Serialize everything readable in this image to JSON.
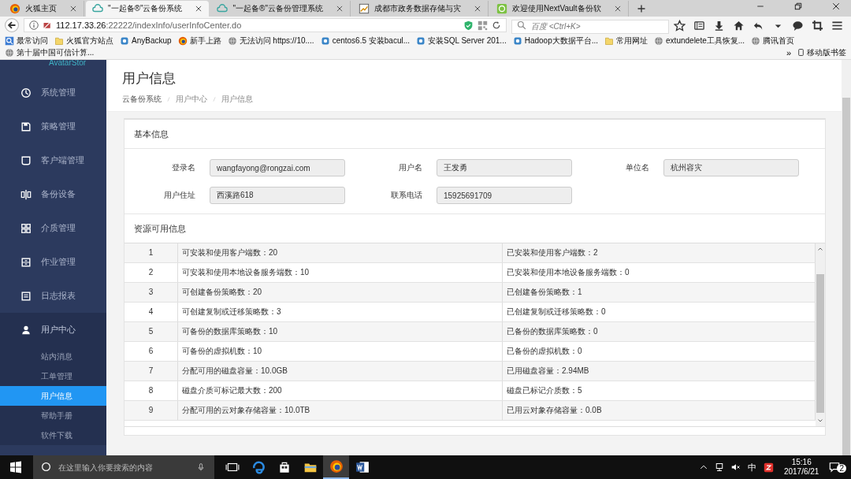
{
  "browser": {
    "tabs": [
      {
        "title": "火狐主页",
        "kind": "firefox",
        "selected": false
      },
      {
        "title": "\"一起备®\"云备份系统",
        "kind": "cloud",
        "selected": true
      },
      {
        "title": "\"一起备®\"云备份管理系统",
        "kind": "cloud",
        "selected": false
      },
      {
        "title": "成都市政务数据存储与灾",
        "kind": "chart",
        "selected": false
      },
      {
        "title": "欢迎使用NextVault备份软",
        "kind": "vault",
        "selected": false
      }
    ],
    "address": {
      "host": "112.17.33.26",
      "path": ":22222/indexInfo/userInfoCenter.do"
    },
    "search": {
      "placeholder": "百度 <Ctrl+K>"
    },
    "bookmarks": [
      {
        "label": "最常访问",
        "kind": "search"
      },
      {
        "label": "火狐官方站点",
        "kind": "folder"
      },
      {
        "label": "AnyBackup",
        "kind": "app"
      },
      {
        "label": "新手上路",
        "kind": "firefox"
      },
      {
        "label": "无法访问 https://10....",
        "kind": "globe"
      },
      {
        "label": "centos6.5 安装bacul...",
        "kind": "app"
      },
      {
        "label": "安装SQL Server 201...",
        "kind": "app"
      },
      {
        "label": "Hadoop大数据平台...",
        "kind": "app"
      },
      {
        "label": "常用网址",
        "kind": "folder"
      },
      {
        "label": "extundelete工具恢复...",
        "kind": "globe"
      },
      {
        "label": "腾讯首页",
        "kind": "globe"
      },
      {
        "label": "第十届中国可信计算...",
        "kind": "globe"
      }
    ],
    "bookmarks_more": "»",
    "mobile_bookmarks": "移动版书签"
  },
  "sidebar": {
    "brand": "AvatarStor",
    "items": [
      {
        "label": "系统管理",
        "kind": "dial",
        "expanded": false
      },
      {
        "label": "策略管理",
        "kind": "save",
        "expanded": false
      },
      {
        "label": "客户端管理",
        "kind": "monitor",
        "expanded": false
      },
      {
        "label": "备份设备",
        "kind": "device",
        "expanded": false
      },
      {
        "label": "介质管理",
        "kind": "grid",
        "expanded": false
      },
      {
        "label": "作业管理",
        "kind": "cabinet",
        "expanded": false
      },
      {
        "label": "日志报表",
        "kind": "report",
        "expanded": false
      },
      {
        "label": "用户中心",
        "kind": "user",
        "expanded": true,
        "children": [
          {
            "label": "站内消息",
            "selected": false
          },
          {
            "label": "工单管理",
            "selected": false
          },
          {
            "label": "用户信息",
            "selected": true
          },
          {
            "label": "帮助手册",
            "selected": false
          },
          {
            "label": "软件下载",
            "selected": false
          }
        ]
      }
    ]
  },
  "page": {
    "title": "用户信息",
    "breadcrumb": [
      "云备份系统",
      "用户中心",
      "用户信息"
    ]
  },
  "basic_info": {
    "title": "基本信息",
    "fields": [
      {
        "label": "登录名",
        "value": "wangfayong@rongzai.com"
      },
      {
        "label": "用户名",
        "value": "王发勇"
      },
      {
        "label": "单位名",
        "value": "杭州容灾"
      },
      {
        "label": "用户住址",
        "value": "西溪路618"
      },
      {
        "label": "联系电话",
        "value": "15925691709"
      }
    ]
  },
  "resources": {
    "title": "资源可用信息",
    "rows": [
      {
        "no": "1",
        "available": "可安装和使用客户端数：20",
        "used": "已安装和使用客户端数：2"
      },
      {
        "no": "2",
        "available": "可安装和使用本地设备服务端数：10",
        "used": "已安装和使用本地设备服务端数：0"
      },
      {
        "no": "3",
        "available": "可创建备份策略数：20",
        "used": "已创建备份策略数：1"
      },
      {
        "no": "4",
        "available": "可创建复制或迁移策略数：3",
        "used": "已创建复制或迁移策略数：0"
      },
      {
        "no": "5",
        "available": "可备份的数据库策略数：10",
        "used": "已备份的数据库策略数：0"
      },
      {
        "no": "6",
        "available": "可备份的虚拟机数：10",
        "used": "已备份的虚拟机数：0"
      },
      {
        "no": "7",
        "available": "分配可用的磁盘容量：10.0GB",
        "used": "已用磁盘容量：2.94MB"
      },
      {
        "no": "8",
        "available": "磁盘介质可标记最大数：200",
        "used": "磁盘已标记介质数：5"
      },
      {
        "no": "9",
        "available": "分配可用的云对象存储容量：10.0TB",
        "used": "已用云对象存储容量：0.0B"
      }
    ]
  },
  "taskbar": {
    "search": {
      "placeholder": "在这里输入你要搜索的内容"
    },
    "apps": [
      {
        "kind": "taskview",
        "selected": false
      },
      {
        "kind": "edge",
        "selected": false
      },
      {
        "kind": "store",
        "selected": false
      },
      {
        "kind": "explorer",
        "selected": false
      },
      {
        "kind": "firefox",
        "selected": true
      },
      {
        "kind": "word",
        "selected": false
      }
    ],
    "ime": "中",
    "time": "15:16",
    "date": "2017/6/21",
    "notifications": "2"
  }
}
